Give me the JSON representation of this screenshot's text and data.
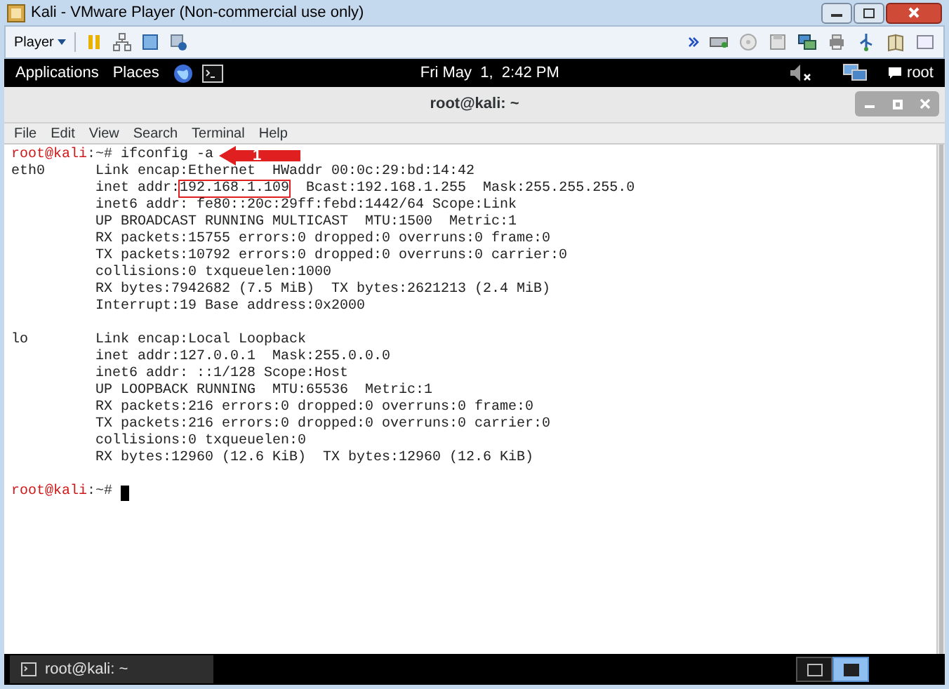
{
  "vm_window": {
    "title": "Kali - VMware Player (Non-commercial use only)"
  },
  "vm_toolbar": {
    "player_menu": "Player"
  },
  "top_panel": {
    "menus": [
      "Applications",
      "Places"
    ],
    "clock": "Fri May  1,  2:42 PM",
    "user": "root"
  },
  "terminal": {
    "title": "root@kali: ~",
    "menu": [
      "File",
      "Edit",
      "View",
      "Search",
      "Terminal",
      "Help"
    ],
    "lines": [
      {
        "kind": "prompt",
        "host": "root@kali",
        "path": ":~#",
        "command": "ifconfig -a",
        "callout": "1",
        "cursor": false
      },
      {
        "kind": "output",
        "label": "eth0",
        "text": "Link encap:Ethernet  HWaddr 00:0c:29:bd:14:42"
      },
      {
        "kind": "boxed",
        "text": "inet addr:",
        "boxed": "192.168.1.109",
        "after": "  Bcast:192.168.1.255  Mask:255.255.255.0"
      },
      {
        "kind": "output",
        "text": "inet6 addr: fe80::20c:29ff:febd:1442/64 Scope:Link"
      },
      {
        "kind": "output",
        "text": "UP BROADCAST RUNNING MULTICAST  MTU:1500  Metric:1"
      },
      {
        "kind": "output",
        "text": "RX packets:15755 errors:0 dropped:0 overruns:0 frame:0"
      },
      {
        "kind": "output",
        "text": "TX packets:10792 errors:0 dropped:0 overruns:0 carrier:0"
      },
      {
        "kind": "output",
        "text": "collisions:0 txqueuelen:1000"
      },
      {
        "kind": "output",
        "text": "RX bytes:7942682 (7.5 MiB)  TX bytes:2621213 (2.4 MiB)"
      },
      {
        "kind": "output",
        "text": "Interrupt:19 Base address:0x2000"
      },
      {
        "kind": "blank"
      },
      {
        "kind": "output",
        "label": "lo",
        "text": "Link encap:Local Loopback"
      },
      {
        "kind": "output",
        "text": "inet addr:127.0.0.1  Mask:255.0.0.0"
      },
      {
        "kind": "output",
        "text": "inet6 addr: ::1/128 Scope:Host"
      },
      {
        "kind": "output",
        "text": "UP LOOPBACK RUNNING  MTU:65536  Metric:1"
      },
      {
        "kind": "output",
        "text": "RX packets:216 errors:0 dropped:0 overruns:0 frame:0"
      },
      {
        "kind": "output",
        "text": "TX packets:216 errors:0 dropped:0 overruns:0 carrier:0"
      },
      {
        "kind": "output",
        "text": "collisions:0 txqueuelen:0"
      },
      {
        "kind": "output",
        "text": "RX bytes:12960 (12.6 KiB)  TX bytes:12960 (12.6 KiB)"
      },
      {
        "kind": "blank"
      },
      {
        "kind": "prompt",
        "host": "root@kali",
        "path": ":~#",
        "cursor": true
      }
    ]
  },
  "taskbar": {
    "windows": [
      {
        "label": "root@kali: ~"
      }
    ],
    "workspaces": [
      {
        "selected": false
      },
      {
        "selected": true
      }
    ]
  }
}
